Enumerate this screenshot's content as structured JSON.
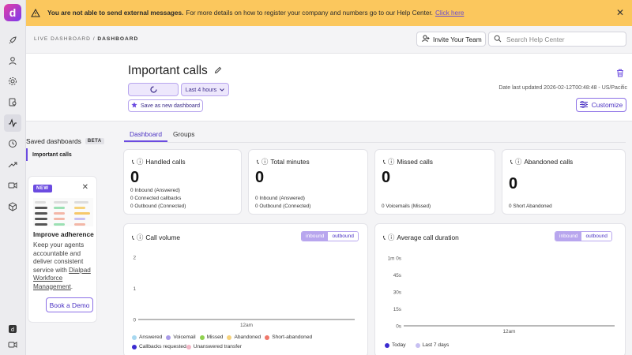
{
  "banner": {
    "bold": "You are not able to send external messages.",
    "text": "For more details on how to register your company and numbers go to our Help Center.",
    "link": "Click here",
    "close": "✕"
  },
  "rail": {
    "logo": "d"
  },
  "header": {
    "crumb_parent": "LIVE DASHBOARD",
    "crumb_sep": " / ",
    "crumb_current": "DASHBOARD",
    "invite": "Invite Your Team",
    "search_placeholder": "Search Help Center"
  },
  "hero": {
    "title": "Important calls",
    "range": "Last 4 hours",
    "save_as": "Save as new dashboard",
    "updated": "Date last updated 2026-02-12T00:48:48 - US/Pacific",
    "customize": "Customize"
  },
  "sidebar": {
    "title": "Saved dashboards",
    "beta": "BETA",
    "items": [
      {
        "label": "Important calls"
      }
    ]
  },
  "promo": {
    "badge": "NEW",
    "close": "✕",
    "heading": "Improve adherence",
    "body_pre": "Keep your agents accountable and deliver consistent service with ",
    "body_link": "Dialpad Workforce Management",
    "body_post": ".",
    "cta": "Book a Demo"
  },
  "tabs": [
    {
      "label": "Dashboard"
    },
    {
      "label": "Groups"
    }
  ],
  "stats": [
    {
      "title": "Handled calls",
      "value": "0",
      "lines": [
        "0 Inbound (Answered)",
        "0 Connected callbacks",
        "0 Outbound (Connected)"
      ]
    },
    {
      "title": "Total minutes",
      "value": "0",
      "lines": [
        "0 Inbound (Answered)",
        "0 Outbound (Connected)"
      ]
    },
    {
      "title": "Missed calls",
      "value": "0",
      "lines": [
        "0 Voicemails (Missed)"
      ]
    },
    {
      "title": "Abandoned calls",
      "value": "0",
      "lines": [
        "0 Short Abandoned"
      ]
    }
  ],
  "charts": [
    {
      "title": "Call volume",
      "toggle": [
        "inbound",
        "outbound"
      ],
      "legend": [
        {
          "label": "Answered",
          "color": "#a7d8f0"
        },
        {
          "label": "Voicemail",
          "color": "#a99be8"
        },
        {
          "label": "Missed",
          "color": "#8fd14f"
        },
        {
          "label": "Abandoned",
          "color": "#f6d27a"
        },
        {
          "label": "Short-abandoned",
          "color": "#f0786b"
        },
        {
          "label": "Callbacks requested",
          "color": "#3b2bd0"
        },
        {
          "label": "Unanswered transfer",
          "color": "#f3b7c7"
        }
      ]
    },
    {
      "title": "Average call duration",
      "toggle": [
        "inbound",
        "outbound"
      ],
      "legend": [
        {
          "label": "Today",
          "color": "#3b2bd0"
        },
        {
          "label": "Last 7 days",
          "color": "#c7c0f2"
        }
      ]
    }
  ],
  "chart_data": [
    {
      "type": "bar",
      "title": "Call volume",
      "categories": [
        "12am"
      ],
      "series": [
        {
          "name": "Answered",
          "values": [
            0
          ]
        },
        {
          "name": "Voicemail",
          "values": [
            0
          ]
        },
        {
          "name": "Missed",
          "values": [
            0
          ]
        },
        {
          "name": "Abandoned",
          "values": [
            0
          ]
        },
        {
          "name": "Short-abandoned",
          "values": [
            0
          ]
        },
        {
          "name": "Callbacks requested",
          "values": [
            0
          ]
        },
        {
          "name": "Unanswered transfer",
          "values": [
            0
          ]
        }
      ],
      "yticks": [
        "0",
        "1",
        "2"
      ],
      "ylim": [
        0,
        2
      ],
      "grid": false,
      "legend_position": "bottom"
    },
    {
      "type": "line",
      "title": "Average call duration",
      "categories": [
        "12am"
      ],
      "series": [
        {
          "name": "Today",
          "values": [
            0
          ]
        },
        {
          "name": "Last 7 days",
          "values": [
            0
          ]
        }
      ],
      "yticks": [
        "0s",
        "15s",
        "30s",
        "45s",
        "1m 0s"
      ],
      "ylim": [
        0,
        60
      ],
      "grid": false,
      "legend_position": "bottom"
    }
  ]
}
